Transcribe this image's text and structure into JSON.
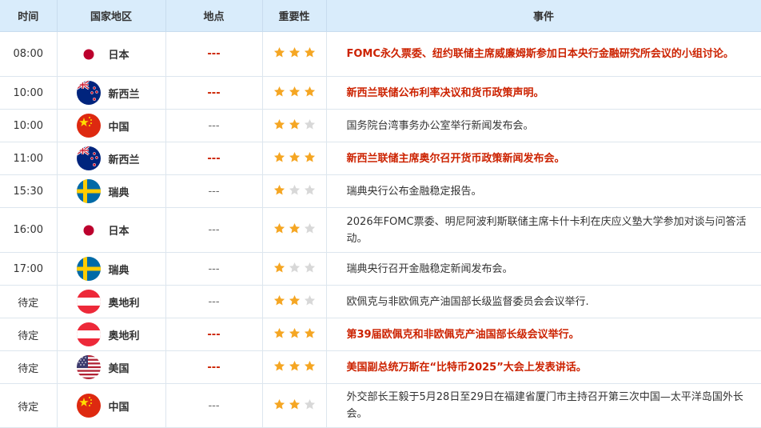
{
  "headers": [
    "时间",
    "国家地区",
    "地点",
    "重要性",
    "事件"
  ],
  "colors": {
    "highlight": "#cc2200",
    "star_on": "#f5a623",
    "star_off": "#d8d8d8",
    "header_bg": "#d9ecfb"
  },
  "rows": [
    {
      "time": "08:00",
      "country": "日本",
      "flag": "japan-flag-icon",
      "place": "---",
      "importance": 3,
      "highlight": true,
      "event": "FOMC永久票委、纽约联储主席威廉姆斯参加日本央行金融研究所会议的小组讨论。"
    },
    {
      "time": "10:00",
      "country": "新西兰",
      "flag": "new-zealand-flag-icon",
      "place": "---",
      "importance": 3,
      "highlight": true,
      "event": "新西兰联储公布利率决议和货币政策声明。"
    },
    {
      "time": "10:00",
      "country": "中国",
      "flag": "china-flag-icon",
      "place": "---",
      "importance": 2,
      "highlight": false,
      "event": "国务院台湾事务办公室举行新闻发布会。"
    },
    {
      "time": "11:00",
      "country": "新西兰",
      "flag": "new-zealand-flag-icon",
      "place": "---",
      "importance": 3,
      "highlight": true,
      "event": "新西兰联储主席奥尔召开货币政策新闻发布会。"
    },
    {
      "time": "15:30",
      "country": "瑞典",
      "flag": "sweden-flag-icon",
      "place": "---",
      "importance": 1,
      "highlight": false,
      "event": "瑞典央行公布金融稳定报告。"
    },
    {
      "time": "16:00",
      "country": "日本",
      "flag": "japan-flag-icon",
      "place": "---",
      "importance": 2,
      "highlight": false,
      "event": "2026年FOMC票委、明尼阿波利斯联储主席卡什卡利在庆应义塾大学参加对谈与问答活动。"
    },
    {
      "time": "17:00",
      "country": "瑞典",
      "flag": "sweden-flag-icon",
      "place": "---",
      "importance": 1,
      "highlight": false,
      "event": "瑞典央行召开金融稳定新闻发布会。"
    },
    {
      "time": "待定",
      "country": "奥地利",
      "flag": "austria-flag-icon",
      "place": "---",
      "importance": 2,
      "highlight": false,
      "event": "欧佩克与非欧佩克产油国部长级监督委员会会议举行."
    },
    {
      "time": "待定",
      "country": "奥地利",
      "flag": "austria-flag-icon",
      "place": "---",
      "importance": 3,
      "highlight": true,
      "event": "第39届欧佩克和非欧佩克产油国部长级会议举行。"
    },
    {
      "time": "待定",
      "country": "美国",
      "flag": "usa-flag-icon",
      "place": "---",
      "importance": 3,
      "highlight": true,
      "event": "美国副总统万斯在“比特币2025”大会上发表讲话。"
    },
    {
      "time": "待定",
      "country": "中国",
      "flag": "china-flag-icon",
      "place": "---",
      "importance": 2,
      "highlight": false,
      "event": "外交部长王毅于5月28日至29日在福建省厦门市主持召开第三次中国—太平洋岛国外长会。"
    }
  ]
}
